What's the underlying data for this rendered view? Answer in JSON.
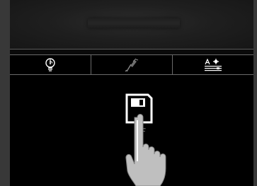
{
  "toolbar": {
    "items": [
      {
        "name": "lightbulb-info-icon"
      },
      {
        "name": "brush-edit-icon"
      },
      {
        "name": "text-settings-icon"
      }
    ]
  },
  "main": {
    "save_label": "…F",
    "icon": "floppy-disk-save-icon",
    "gesture": "tap-hand-icon"
  },
  "colors": {
    "background": "#000000",
    "frame": "#383838",
    "border": "#6a6a6a",
    "icon": "#ffffff",
    "hand": "#bfbfbf"
  }
}
